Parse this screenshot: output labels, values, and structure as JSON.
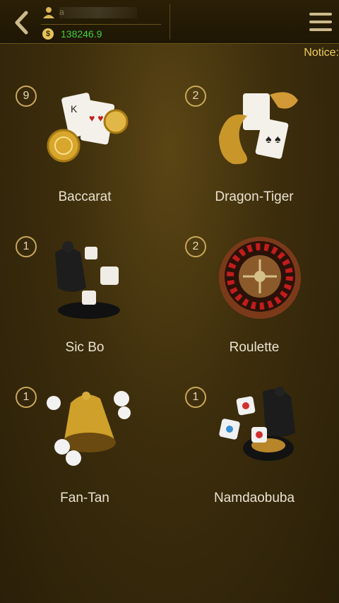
{
  "header": {
    "user_name": "a",
    "balance": "138246.9",
    "coin_symbol": "$",
    "notice_label": "Notice:"
  },
  "icons": {
    "back": "chevron-left-icon",
    "menu": "hamburger-menu-icon",
    "user": "user-icon",
    "coin": "dollar-coin-icon"
  },
  "games": [
    {
      "name": "Baccarat",
      "count": "9",
      "icon": "cards-and-chips-icon"
    },
    {
      "name": "Dragon-Tiger",
      "count": "2",
      "icon": "dragon-tiger-cards-icon"
    },
    {
      "name": "Sic Bo",
      "count": "1",
      "icon": "dice-cup-icon"
    },
    {
      "name": "Roulette",
      "count": "2",
      "icon": "roulette-wheel-icon"
    },
    {
      "name": "Fan-Tan",
      "count": "1",
      "icon": "bell-and-beads-icon"
    },
    {
      "name": "Namdaobuba",
      "count": "1",
      "icon": "fish-prawn-crab-dice-icon"
    }
  ],
  "colors": {
    "accent": "#caa85a",
    "balance": "#3fcf3f",
    "notice": "#f0d060"
  }
}
